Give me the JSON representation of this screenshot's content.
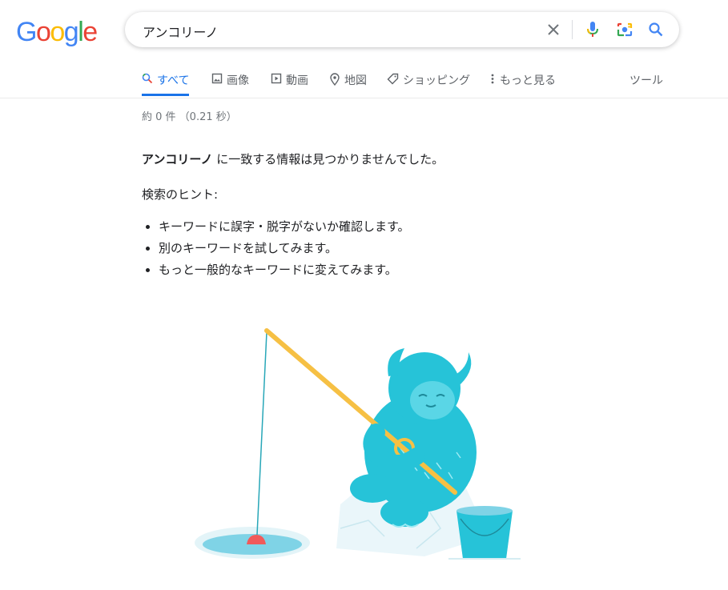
{
  "logo": {
    "text": "Google",
    "letters": [
      "G",
      "o",
      "o",
      "g",
      "l",
      "e"
    ],
    "colors": [
      "#4285F4",
      "#EA4335",
      "#FBBC05",
      "#4285F4",
      "#34A853",
      "#EA4335"
    ]
  },
  "search": {
    "query": "アンコリーノ",
    "icons": [
      "close-icon",
      "mic-icon",
      "lens-camera-icon",
      "search-icon"
    ]
  },
  "tabs": [
    {
      "label": "すべて",
      "icon": "search-icon",
      "active": true
    },
    {
      "label": "画像",
      "icon": "image-icon"
    },
    {
      "label": "動画",
      "icon": "play-icon"
    },
    {
      "label": "地図",
      "icon": "map-pin-icon"
    },
    {
      "label": "ショッピング",
      "icon": "tag-icon"
    },
    {
      "label": "もっと見る",
      "icon": "more-vert-icon"
    }
  ],
  "tools_label": "ツール",
  "stats": "約 0 件 （0.21 秒）",
  "no_results": {
    "query": "アンコリーノ",
    "suffix": " に一致する情報は見つかりませんでした。"
  },
  "hint_title": "検索のヒント:",
  "hints": [
    "キーワードに誤字・脱字がないか確認します。",
    "別のキーワードを試してみます。",
    "もっと一般的なキーワードに変えてみます。"
  ],
  "colors": {
    "accent": "#1a73e8",
    "text": "#202124",
    "muted": "#70757a",
    "tab": "#5f6368"
  }
}
